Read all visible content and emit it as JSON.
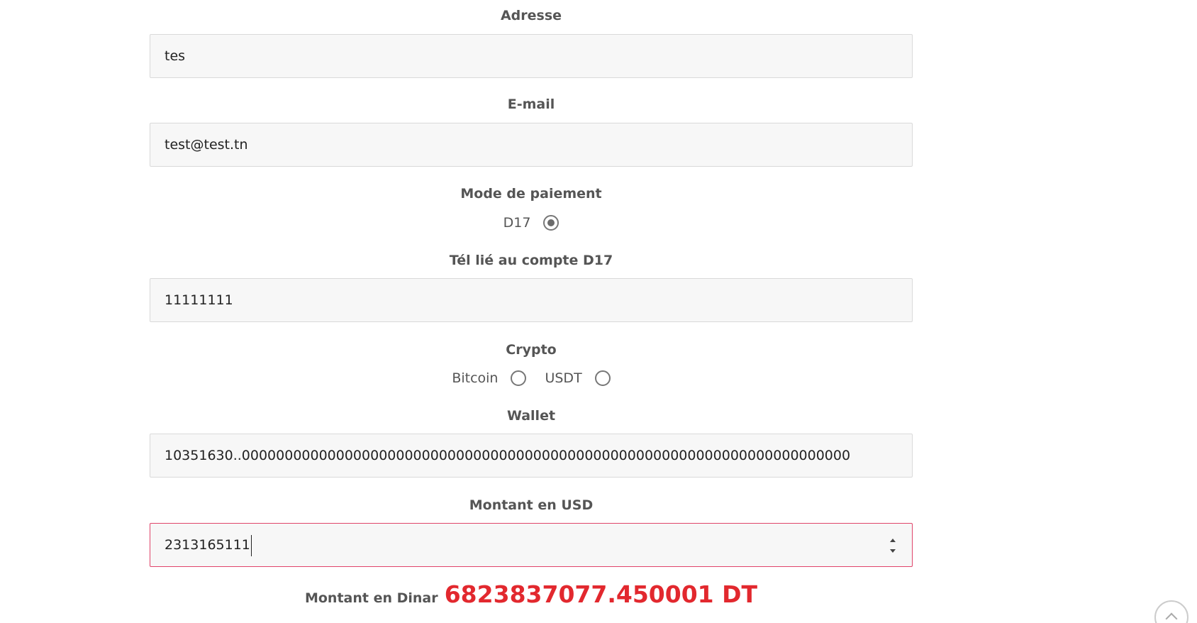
{
  "form": {
    "address": {
      "label": "Adresse",
      "value": "tes"
    },
    "email": {
      "label": "E-mail",
      "value": "test@test.tn"
    },
    "payment_mode": {
      "label": "Mode de paiement",
      "option": {
        "label": "D17",
        "checked": true
      }
    },
    "phone": {
      "label": "Tél lié au compte D17",
      "value": "11111111"
    },
    "crypto": {
      "label": "Crypto",
      "options": [
        {
          "label": "Bitcoin",
          "checked": false
        },
        {
          "label": "USDT",
          "checked": false
        }
      ]
    },
    "wallet": {
      "label": "Wallet",
      "value": "10351630..00000000000000000000000000000000000000000000000000000000000000000000000"
    },
    "amount_usd": {
      "label": "Montant en USD",
      "value": "2313165111"
    },
    "amount_dinar": {
      "label": "Montant en Dinar",
      "value": "6823837077.450001 DT"
    }
  },
  "colors": {
    "accent_red": "#e2282e",
    "focus_border": "#e0446a",
    "field_bg": "#f7f7f7"
  },
  "icons": {
    "scroll_top": "chevron-up-icon",
    "spinner": "number-spinner-icon"
  }
}
